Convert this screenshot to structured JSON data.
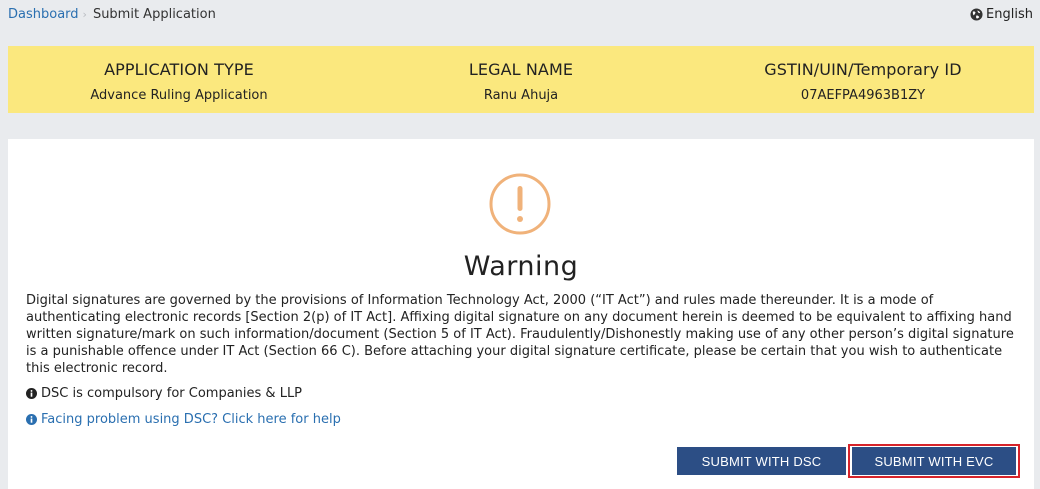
{
  "breadcrumb": {
    "home": "Dashboard",
    "separator": "›",
    "current": "Submit Application"
  },
  "language": {
    "label": "English",
    "icon": "globe-icon"
  },
  "application_info": {
    "columns": [
      {
        "heading": "APPLICATION TYPE",
        "value": "Advance Ruling Application"
      },
      {
        "heading": "LEGAL NAME",
        "value": "Ranu Ahuja"
      },
      {
        "heading": "GSTIN/UIN/Temporary ID",
        "value": "07AEFPA4963B1ZY"
      }
    ],
    "background_color": "#fbe87e"
  },
  "warning": {
    "icon": "exclamation-circle-icon",
    "icon_color": "#f0b27a",
    "title": "Warning",
    "text": "Digital signatures are governed by the provisions of Information Technology Act, 2000 (“IT Act”) and rules made thereunder. It is a mode of authenticating electronic records [Section 2(p) of IT Act]. Affixing digital signature on any document herein is deemed to be equivalent to affixing hand written signature/mark on such information/document (Section 5 of IT Act). Fraudulently/Dishonestly making use of any other person’s digital signature is a punishable offence under IT Act (Section 66 C). Before attaching your digital signature certificate, please be certain that you wish to authenticate this electronic record."
  },
  "notes": {
    "dsc_compulsory": "DSC is compulsory for Companies & LLP",
    "help_link": "Facing problem using DSC? Click here for help"
  },
  "actions": {
    "submit_dsc": "SUBMIT WITH DSC",
    "submit_evc": "SUBMIT WITH EVC"
  },
  "colors": {
    "button": "#2c4e85",
    "highlight_border": "#d6232a",
    "link": "#2a6fb0"
  }
}
